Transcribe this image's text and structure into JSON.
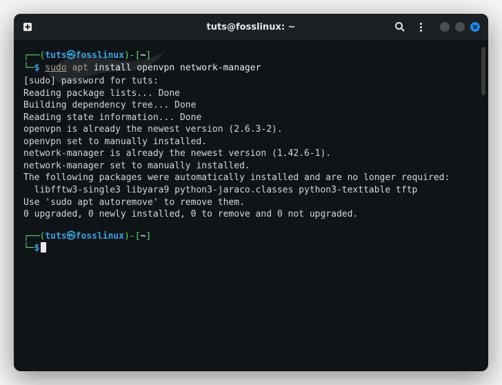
{
  "titlebar": {
    "title": "tuts@fosslinux: ~"
  },
  "prompt1": {
    "open": "┌──(",
    "user": "tuts",
    "at": "㉿",
    "host": "fosslinux",
    "close1": ")-[",
    "path": "~",
    "close2": "]",
    "line2a": "└─",
    "dollar": "$",
    "cmd_sudo": "sudo",
    "cmd_apt": "apt",
    "cmd_rest": "install openvpn network-manager"
  },
  "output": {
    "l1": "[sudo] password for tuts:",
    "l2": "Reading package lists... Done",
    "l3": "Building dependency tree... Done",
    "l4": "Reading state information... Done",
    "l5": "openvpn is already the newest version (2.6.3-2).",
    "l6": "openvpn set to manually installed.",
    "l7": "network-manager is already the newest version (1.42.6-1).",
    "l8": "network-manager set to manually installed.",
    "l9": "The following packages were automatically installed and are no longer required:",
    "l10": "  libfftw3-single3 libyara9 python3-jaraco.classes python3-texttable tftp",
    "l11": "Use 'sudo apt autoremove' to remove them.",
    "l12": "0 upgraded, 0 newly installed, 0 to remove and 0 not upgraded."
  },
  "prompt2": {
    "open": "┌──(",
    "user": "tuts",
    "at": "㉿",
    "host": "fosslinux",
    "close1": ")-[",
    "path": "~",
    "close2": "]",
    "line2a": "└─",
    "dollar": "$"
  }
}
